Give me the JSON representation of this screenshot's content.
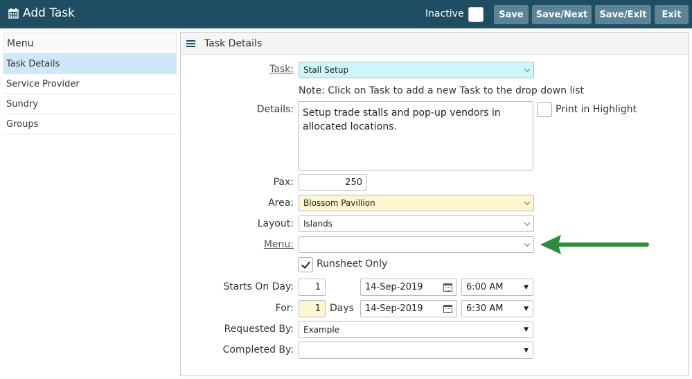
{
  "header": {
    "icon": "calendar-icon",
    "title": "Add Task",
    "inactive_label": "Inactive",
    "buttons": {
      "save": "Save",
      "save_next": "Save/Next",
      "save_exit": "Save/Exit",
      "exit": "Exit"
    }
  },
  "sidebar": {
    "title": "Menu",
    "items": [
      {
        "label": "Task Details",
        "active": true
      },
      {
        "label": "Service Provider",
        "active": false
      },
      {
        "label": "Sundry",
        "active": false
      },
      {
        "label": "Groups",
        "active": false
      }
    ]
  },
  "panel": {
    "title": "Task Details",
    "task": {
      "label": "Task:",
      "value": "Stall Setup",
      "note": "Note: Click on Task to add a new Task to the drop down list"
    },
    "details": {
      "label": "Details:",
      "value": "Setup trade stalls and pop-up vendors in allocated locations.",
      "print_label": "Print in Highlight"
    },
    "pax": {
      "label": "Pax:",
      "value": "250"
    },
    "area": {
      "label": "Area:",
      "value": "Blossom Pavillion"
    },
    "layout": {
      "label": "Layout:",
      "value": "Islands"
    },
    "menu": {
      "label": "Menu:",
      "value": ""
    },
    "runsheet": {
      "label": "Runsheet Only",
      "checked": true
    },
    "starts": {
      "label": "Starts On Day:",
      "day": "1",
      "date": "14-Sep-2019",
      "time": "6:00 AM"
    },
    "for": {
      "label": "For:",
      "days": "1",
      "days_label": "Days",
      "date": "14-Sep-2019",
      "time": "6:30 AM"
    },
    "requested_by": {
      "label": "Requested By:",
      "value": "Example"
    },
    "completed_by": {
      "label": "Completed By:",
      "value": ""
    }
  },
  "colors": {
    "header_bg": "#1f4e63",
    "button_bg": "#5b8496",
    "active_item": "#cde8f6",
    "task_field": "#ccf6f9",
    "area_field": "#fdf6cf",
    "arrow": "#2e8b3a"
  }
}
